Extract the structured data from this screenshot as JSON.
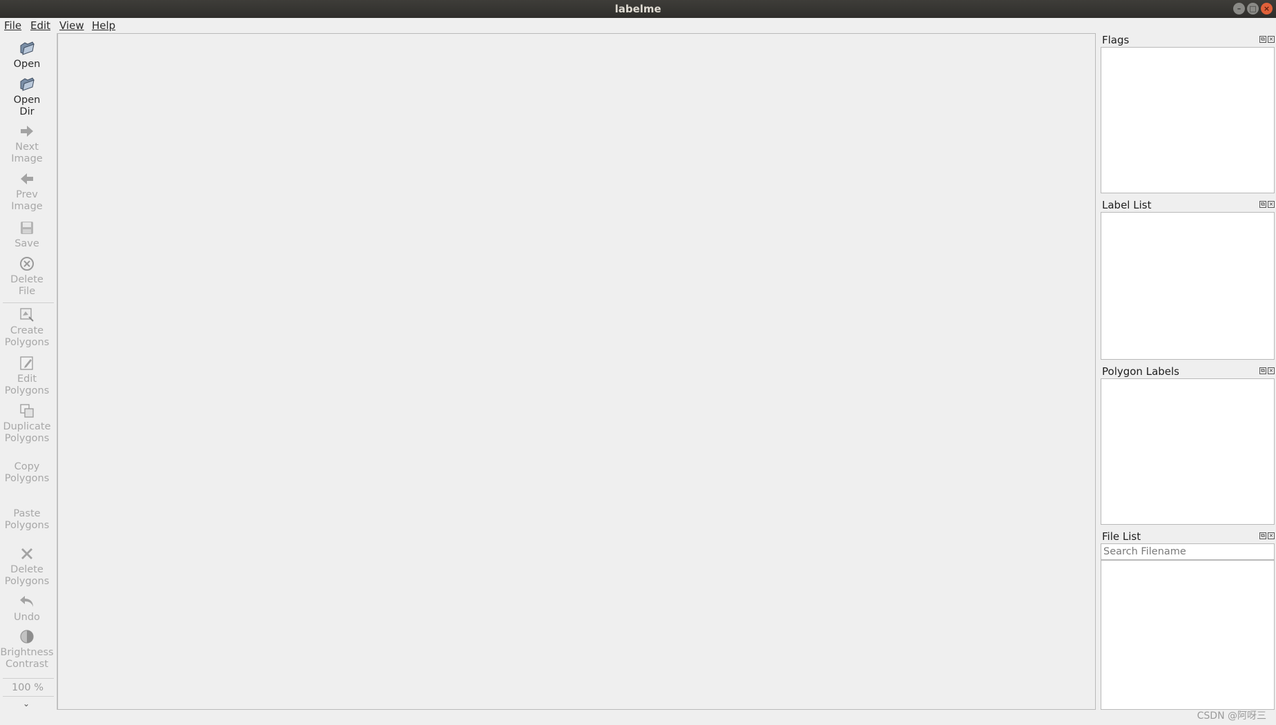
{
  "window": {
    "title": "labelme"
  },
  "menu": [
    "File",
    "Edit",
    "View",
    "Help"
  ],
  "toolbar": {
    "open": "Open",
    "open_dir": [
      "Open",
      "Dir"
    ],
    "next_image": [
      "Next",
      "Image"
    ],
    "prev_image": [
      "Prev",
      "Image"
    ],
    "save": "Save",
    "delete_file": [
      "Delete",
      "File"
    ],
    "create_polygons": [
      "Create",
      "Polygons"
    ],
    "edit_polygons": [
      "Edit",
      "Polygons"
    ],
    "duplicate_polygons": [
      "Duplicate",
      "Polygons"
    ],
    "copy_polygons": [
      "Copy",
      "Polygons"
    ],
    "paste_polygons": [
      "Paste",
      "Polygons"
    ],
    "delete_polygons": [
      "Delete",
      "Polygons"
    ],
    "undo": "Undo",
    "brightness_contrast": [
      "Brightness",
      "Contrast"
    ],
    "zoom": "100 %"
  },
  "docks": {
    "flags": "Flags",
    "label_list": "Label List",
    "polygon_labels": "Polygon Labels",
    "file_list": "File List",
    "search_placeholder": "Search Filename"
  },
  "watermark": "CSDN @阿呀三"
}
